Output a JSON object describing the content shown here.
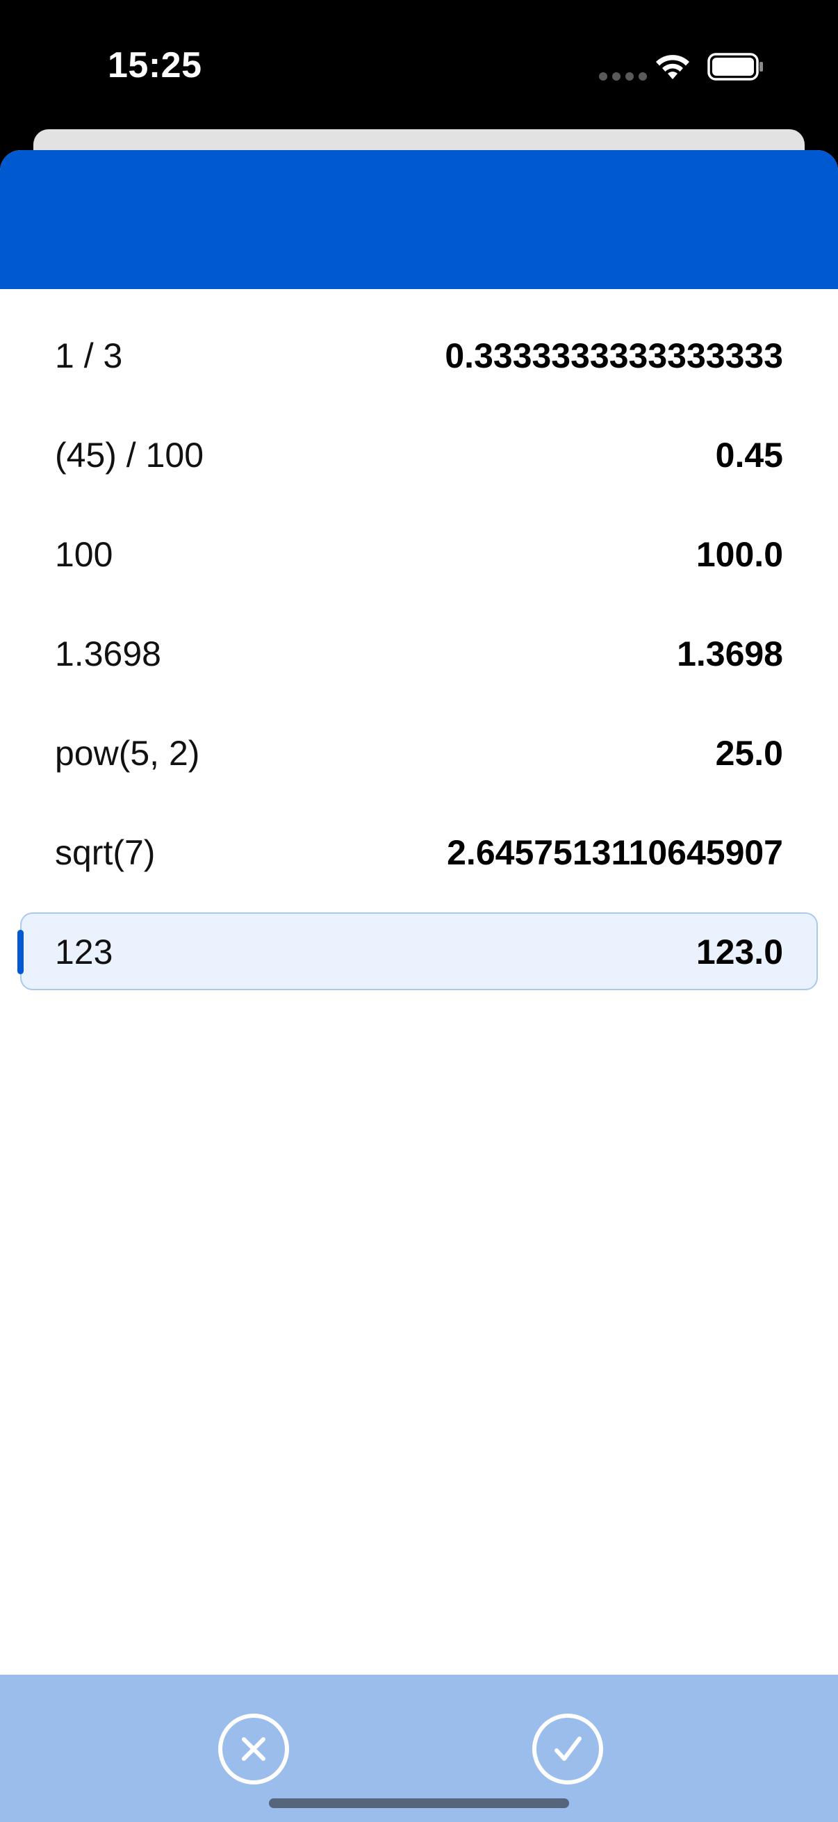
{
  "status_bar": {
    "time": "15:25",
    "icons": [
      "signal-dots-icon",
      "wifi-icon",
      "battery-icon"
    ]
  },
  "colors": {
    "header_blue": "#0059d1",
    "bottom_bar": "#9bbdec",
    "selected_row_bg": "#eaf3fd",
    "selected_row_border": "#a9c9f1"
  },
  "history": [
    {
      "expression": "1 / 3",
      "result": "0.3333333333333333",
      "selected": false
    },
    {
      "expression": "(45) / 100",
      "result": "0.45",
      "selected": false
    },
    {
      "expression": "100",
      "result": "100.0",
      "selected": false
    },
    {
      "expression": "1.3698",
      "result": "1.3698",
      "selected": false
    },
    {
      "expression": "pow(5, 2)",
      "result": "25.0",
      "selected": false
    },
    {
      "expression": "sqrt(7)",
      "result": "2.6457513110645907",
      "selected": false
    },
    {
      "expression": "123",
      "result": "123.0",
      "selected": true
    }
  ],
  "actions": {
    "cancel_icon": "close-circle-icon",
    "confirm_icon": "check-circle-icon"
  }
}
